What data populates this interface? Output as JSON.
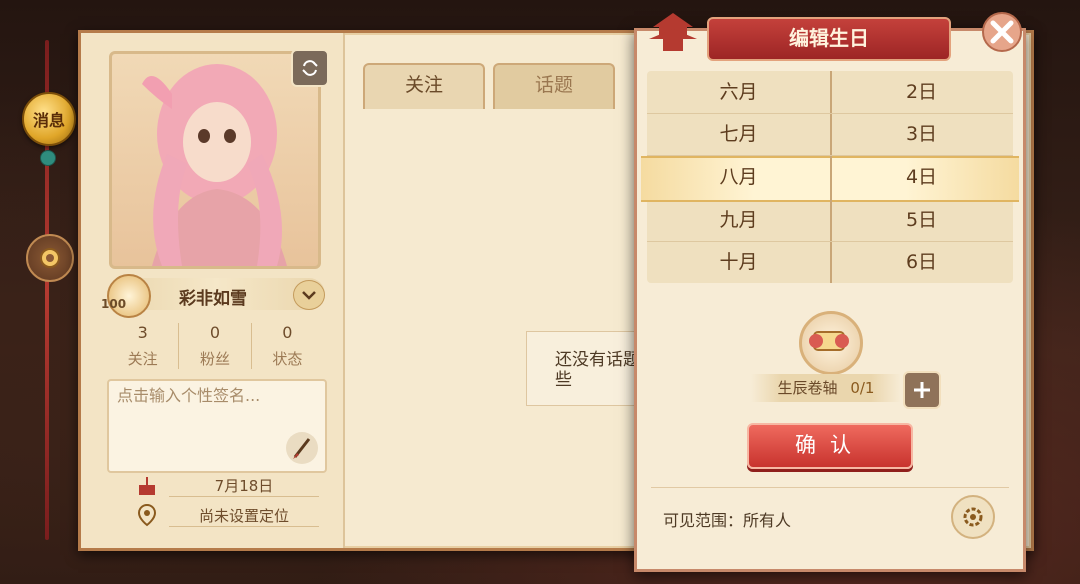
{
  "rail": {
    "message_label": "消息"
  },
  "profile": {
    "level": "100",
    "name": "彩非如雪",
    "stats": [
      {
        "value": "3",
        "label": "关注"
      },
      {
        "value": "0",
        "label": "粉丝"
      },
      {
        "value": "0",
        "label": "状态"
      }
    ],
    "signature_placeholder": "点击输入个性签名...",
    "birthday": "7月18日",
    "location": "尚未设置定位"
  },
  "tabs": [
    {
      "label": "关注"
    },
    {
      "label": "话题"
    }
  ],
  "empty_text": "还没有话题\n些",
  "dialog": {
    "title": "编辑生日",
    "months": [
      "六月",
      "七月",
      "八月",
      "九月",
      "十月"
    ],
    "days": [
      "2日",
      "3日",
      "4日",
      "5日",
      "6日"
    ],
    "selected_month": "八月",
    "selected_day": "4日",
    "item_label": "生辰卷轴",
    "item_count": "0/1",
    "confirm_label": "确认",
    "visibility_label": "可见范围：所有人"
  },
  "colors": {
    "accent_red": "#c8332e",
    "parchment": "#f6ead0",
    "text_brown": "#5e3d1f"
  }
}
